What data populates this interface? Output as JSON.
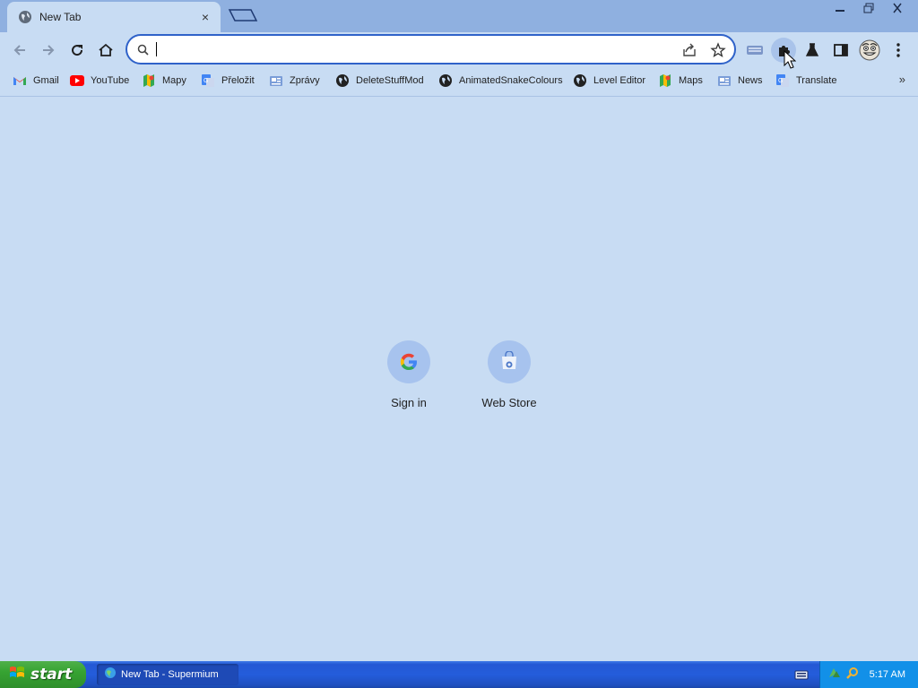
{
  "tab": {
    "title": "New Tab",
    "close_glyph": "×"
  },
  "window": {
    "minimize_glyph": "▭",
    "restore_glyph": "❐",
    "close_glyph": "✕"
  },
  "omnibox": {
    "value": "",
    "placeholder": ""
  },
  "bookmarks": [
    {
      "label": "Gmail",
      "icon": "gmail-icon"
    },
    {
      "label": "YouTube",
      "icon": "youtube-icon"
    },
    {
      "label": "Mapy",
      "icon": "maps-icon"
    },
    {
      "label": "Přeložit",
      "icon": "translate-icon"
    },
    {
      "label": "Zprávy",
      "icon": "news-icon"
    },
    {
      "label": "DeleteStuffMod",
      "icon": "globe-icon"
    },
    {
      "label": "AnimatedSnakeColours",
      "icon": "globe-icon"
    },
    {
      "label": "Level Editor",
      "icon": "globe-icon"
    },
    {
      "label": "Maps",
      "icon": "maps-icon"
    },
    {
      "label": "News",
      "icon": "news-icon"
    },
    {
      "label": "Translate",
      "icon": "translate-icon"
    }
  ],
  "bookmarks_more_glyph": "»",
  "shortcuts": [
    {
      "label": "Sign in",
      "icon": "google-icon"
    },
    {
      "label": "Web Store",
      "icon": "web-store-icon"
    }
  ],
  "taskbar": {
    "start_label": "start",
    "task_label": "New Tab - Supermium",
    "clock": "5:17 AM"
  },
  "colors": {
    "page_bg": "#c8dcf3",
    "tabstrip_bg": "#8fb0e0",
    "omnibox_border": "#2f62c9",
    "taskbar_blue": "#245ddb",
    "start_green": "#36a332",
    "tray_blue": "#1290e8"
  }
}
